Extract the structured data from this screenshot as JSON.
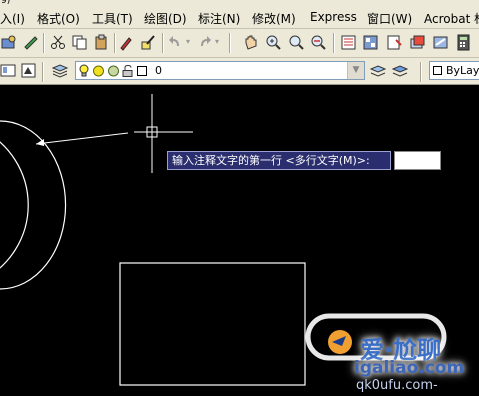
{
  "title_fragment": "9)",
  "menu": [
    {
      "label": "入(I)"
    },
    {
      "label": "格式(O)"
    },
    {
      "label": "工具(T)"
    },
    {
      "label": "绘图(D)"
    },
    {
      "label": "标注(N)"
    },
    {
      "label": "修改(M)"
    },
    {
      "label": "Express"
    },
    {
      "label": "窗口(W)"
    },
    {
      "label": "Acrobat 标"
    }
  ],
  "layer_toolbar": {
    "current_layer": "0",
    "linetype_combo": "ByLay"
  },
  "command_prompt": {
    "text": "输入注释文字的第一行 <多行文字(M)>:",
    "input_value": ""
  },
  "watermark": {
    "brand": "爱·尬聊",
    "url": "igaliao.com",
    "footer": "qk0ufu.com-"
  },
  "colors": {
    "background": "#000000",
    "ui_face": "#ece9d8",
    "prompt_bg": "#2a2d6e",
    "drawing_lines": "#ffffff"
  }
}
